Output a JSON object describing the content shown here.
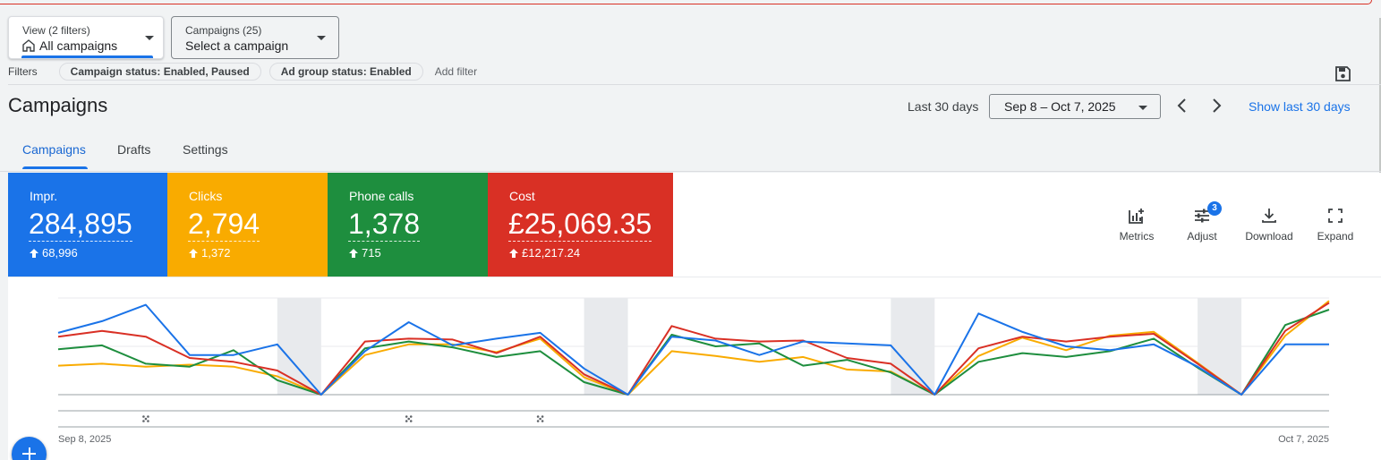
{
  "view_filter": {
    "label": "View (2 filters)",
    "value": "All campaigns"
  },
  "campaign_select": {
    "label": "Campaigns (25)",
    "value": "Select a campaign"
  },
  "filters": {
    "label": "Filters",
    "chips": [
      "Campaign status: Enabled, Paused",
      "Ad group status: Enabled"
    ],
    "add_filter": "Add filter"
  },
  "page": {
    "title": "Campaigns"
  },
  "date_range": {
    "preset_label": "Last 30 days",
    "value": "Sep 8 – Oct 7, 2025",
    "show_last_link": "Show last 30 days"
  },
  "tabs": [
    {
      "label": "Campaigns",
      "active": true
    },
    {
      "label": "Drafts",
      "active": false
    },
    {
      "label": "Settings",
      "active": false
    }
  ],
  "metric_cards": [
    {
      "label": "Impr.",
      "value": "284,895",
      "delta": "68,996",
      "color": "#1a73e8"
    },
    {
      "label": "Clicks",
      "value": "2,794",
      "delta": "1,372",
      "color": "#f9ab00"
    },
    {
      "label": "Phone calls",
      "value": "1,378",
      "delta": "715",
      "color": "#1e8e3e"
    },
    {
      "label": "Cost",
      "value": "£25,069.35",
      "delta": "£12,217.24",
      "color": "#d93025"
    }
  ],
  "toolbar": {
    "metrics": "Metrics",
    "adjust": "Adjust",
    "adjust_badge": "3",
    "download": "Download",
    "expand": "Expand"
  },
  "chart_data": {
    "type": "line",
    "x_start_label": "Sep 8, 2025",
    "x_end_label": "Oct 7, 2025",
    "x": [
      "Sep 8",
      "Sep 9",
      "Sep 10",
      "Sep 11",
      "Sep 12",
      "Sep 13",
      "Sep 14",
      "Sep 15",
      "Sep 16",
      "Sep 17",
      "Sep 18",
      "Sep 19",
      "Sep 20",
      "Sep 21",
      "Sep 22",
      "Sep 23",
      "Sep 24",
      "Sep 25",
      "Sep 26",
      "Sep 27",
      "Sep 28",
      "Sep 29",
      "Sep 30",
      "Oct 1",
      "Oct 2",
      "Oct 3",
      "Oct 4",
      "Oct 5",
      "Oct 6",
      "Oct 7"
    ],
    "shaded_ranges": [
      [
        5,
        6
      ],
      [
        12,
        13
      ],
      [
        19,
        20
      ],
      [
        26,
        27
      ]
    ],
    "y_scale": "normalized",
    "ylim": [
      0,
      100
    ],
    "series": [
      {
        "color": "#1a73e8",
        "values": [
          64,
          76,
          93,
          41,
          41,
          52,
          0,
          45,
          75,
          51,
          58,
          64,
          27,
          0,
          60,
          56,
          41,
          55,
          53,
          51,
          0,
          84,
          65,
          50,
          46,
          52,
          29,
          0,
          52,
          52
        ]
      },
      {
        "color": "#d93025",
        "values": [
          60,
          66,
          60,
          38,
          34,
          25,
          0,
          55,
          58,
          57,
          43,
          60,
          21,
          0,
          71,
          58,
          55,
          56,
          38,
          32,
          0,
          48,
          60,
          55,
          60,
          63,
          32,
          0,
          66,
          95
        ]
      },
      {
        "color": "#f9ab00",
        "values": [
          30,
          32,
          29,
          31,
          29,
          19,
          0,
          41,
          52,
          52,
          44,
          58,
          18,
          0,
          45,
          40,
          34,
          39,
          26,
          24,
          0,
          40,
          59,
          46,
          61,
          65,
          33,
          0,
          61,
          97
        ]
      },
      {
        "color": "#1e8e3e",
        "values": [
          47,
          51,
          32,
          29,
          46,
          15,
          0,
          48,
          55,
          49,
          39,
          45,
          13,
          0,
          62,
          50,
          53,
          30,
          36,
          23,
          0,
          34,
          43,
          39,
          45,
          58,
          28,
          0,
          72,
          88
        ]
      }
    ]
  }
}
